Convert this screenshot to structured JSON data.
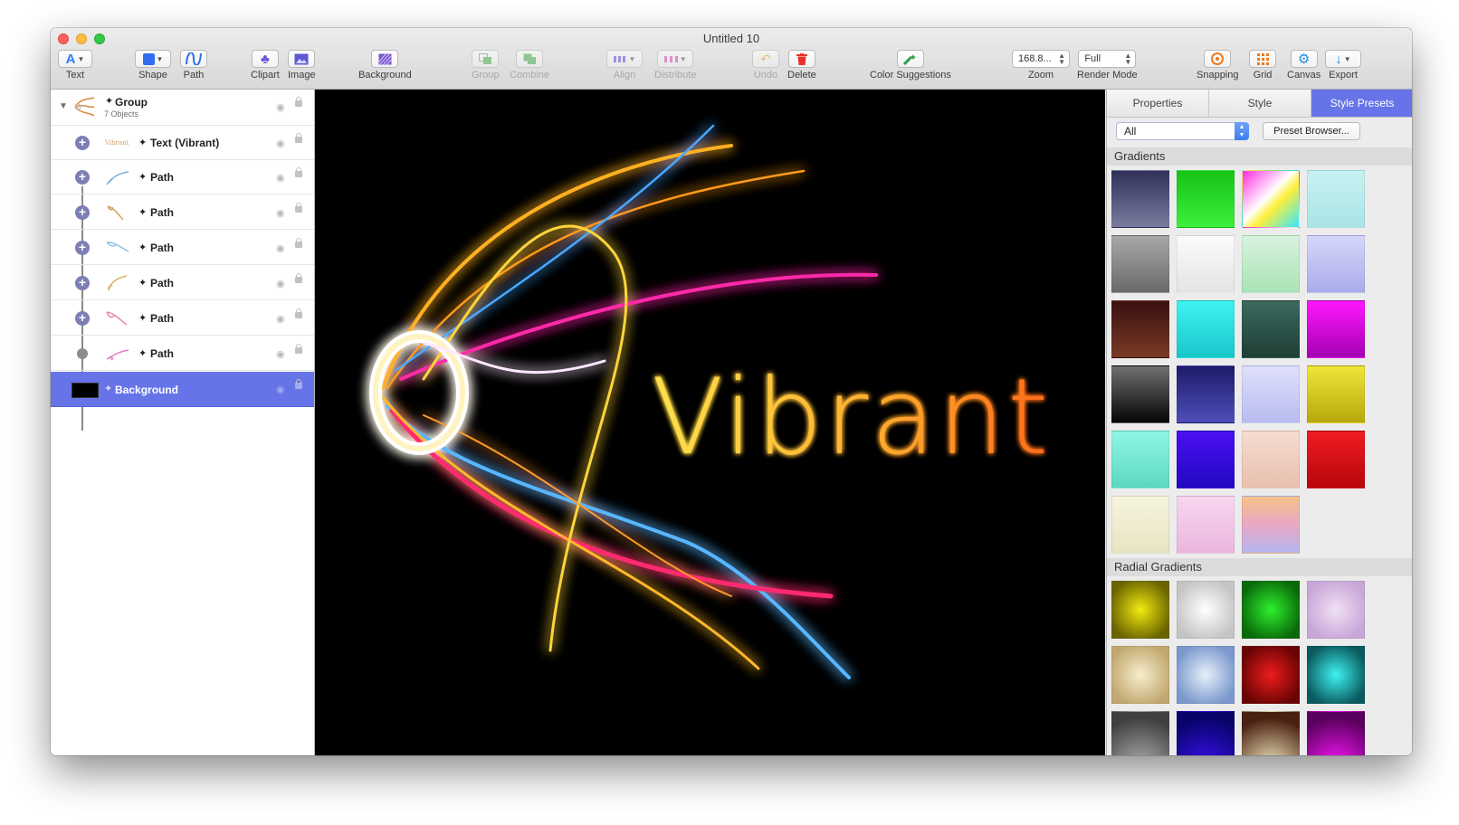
{
  "window": {
    "title": "Untitled 10"
  },
  "toolbar": {
    "text": "Text",
    "shape": "Shape",
    "path": "Path",
    "clipart": "Clipart",
    "image": "Image",
    "background": "Background",
    "group": "Group",
    "combine": "Combine",
    "align": "Align",
    "distribute": "Distribute",
    "undo": "Undo",
    "delete": "Delete",
    "color_suggestions": "Color Suggestions",
    "zoom_value": "168.8...",
    "zoom": "Zoom",
    "render_mode_value": "Full",
    "render_mode": "Render Mode",
    "snapping": "Snapping",
    "grid": "Grid",
    "canvas": "Canvas",
    "export": "Export"
  },
  "layers": {
    "group": {
      "name": "Group",
      "count": "7 Objects"
    },
    "items": [
      {
        "name": "Text (Vibrant)"
      },
      {
        "name": "Path"
      },
      {
        "name": "Path"
      },
      {
        "name": "Path"
      },
      {
        "name": "Path"
      },
      {
        "name": "Path"
      },
      {
        "name": "Path"
      }
    ],
    "background": {
      "name": "Background"
    }
  },
  "canvas": {
    "text": "Vibrant"
  },
  "panel": {
    "tabs": [
      "Properties",
      "Style",
      "Style Presets"
    ],
    "active_tab": "Style Presets",
    "filter_value": "All",
    "preset_browser": "Preset Browser...",
    "sections": [
      "Gradients",
      "Radial Gradients"
    ]
  },
  "colors": {
    "accent": "#6674e8",
    "canvas_bg": "#000000"
  }
}
